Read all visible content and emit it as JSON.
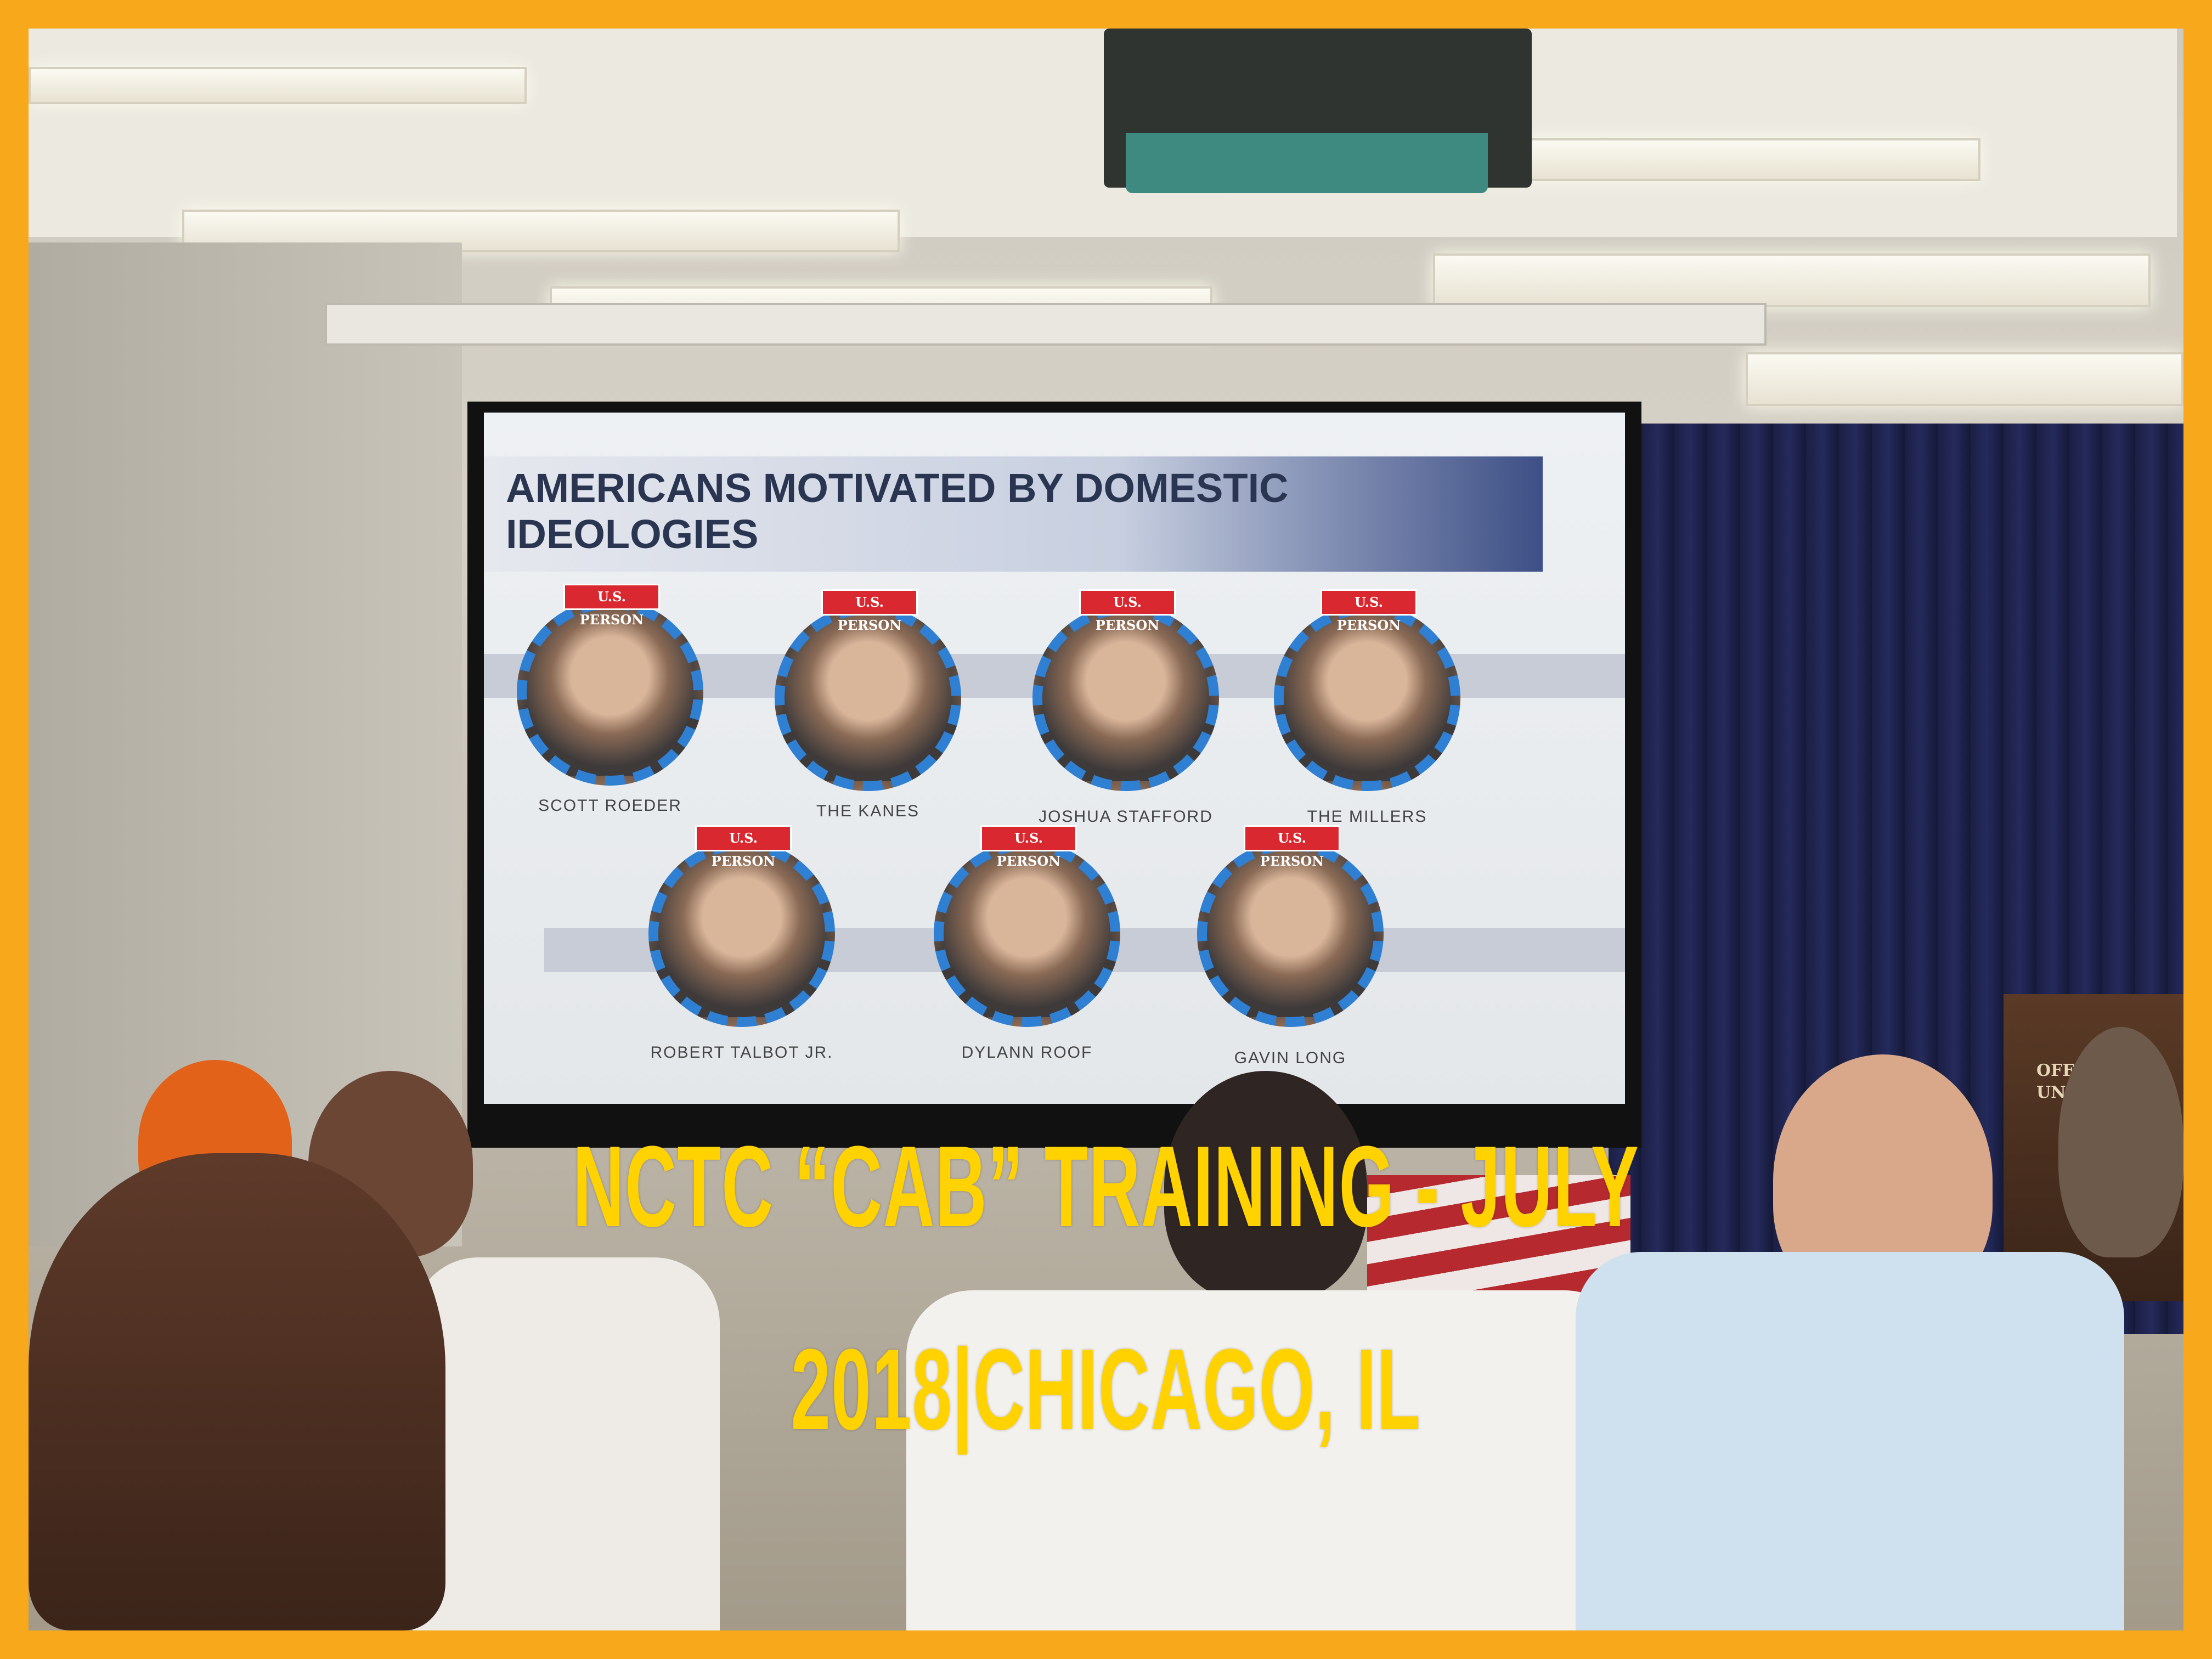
{
  "overlay": {
    "line1": "NCTC “CAB” TRAINING - JULY",
    "line2": "2018|CHICAGO, IL",
    "color": "#ffd200"
  },
  "frame": {
    "color": "#f7a81b"
  },
  "slide": {
    "title_line1": "AMERICANS MOTIVATED BY DOMESTIC",
    "title_line2": "IDEOLOGIES",
    "tag_label": "U.S. PERSON",
    "people": [
      {
        "name": "SCOTT ROEDER"
      },
      {
        "name": "THE KANES"
      },
      {
        "name": "JOSHUA STAFFORD"
      },
      {
        "name": "THE MILLERS"
      },
      {
        "name": "ROBERT TALBOT JR."
      },
      {
        "name": "DYLANN ROOF"
      },
      {
        "name": "GAVIN LONG"
      }
    ]
  },
  "podium": {
    "line1": "OFF",
    "line2": "UNITED"
  }
}
